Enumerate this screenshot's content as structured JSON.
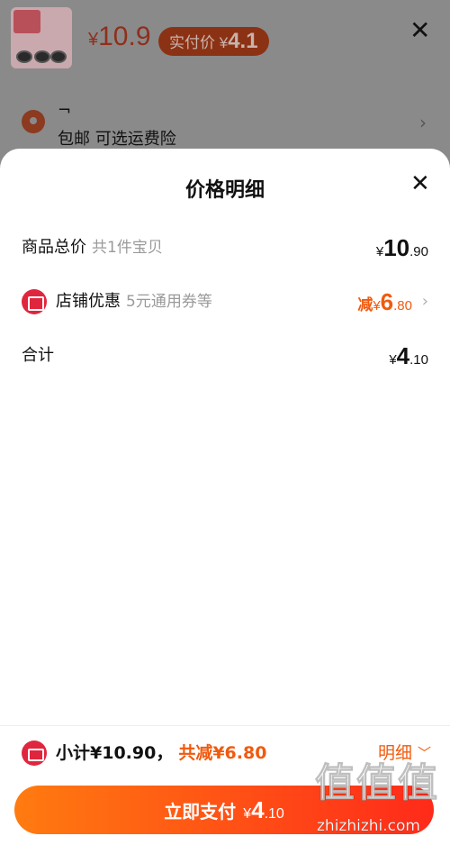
{
  "product": {
    "price_symbol": "¥",
    "price": "10.9",
    "paid_label": "实付价",
    "paid_symbol": "¥",
    "paid_value": "4.1"
  },
  "address": {
    "line1": "¬",
    "line2": "包邮 可选运费险"
  },
  "sheet": {
    "title": "价格明细",
    "rows": {
      "total": {
        "label": "商品总价",
        "sub": "共1件宝贝",
        "yen": "¥",
        "int": "10",
        "dec": ".90"
      },
      "shop_discount": {
        "label": "店铺优惠",
        "sub": "5元通用券等",
        "prefix": "减",
        "yen": "¥",
        "int": "6",
        "dec": ".80"
      },
      "sum": {
        "label": "合计",
        "yen": "¥",
        "int": "4",
        "dec": ".10"
      }
    }
  },
  "footer": {
    "subtotal": "小计¥10.90，",
    "saving": "共减¥6.80",
    "detail": "明细",
    "pay_label": "立即支付",
    "pay_yen": "¥",
    "pay_int": "4",
    "pay_dec": ".10"
  },
  "watermark": {
    "big": "值值值",
    "small": "zhizhizhi.com"
  },
  "colors": {
    "accent": "#f15a0e",
    "shop_icon": "#e0263e",
    "pay_gradient_start": "#ff7b10",
    "pay_gradient_end": "#ff2a1a"
  },
  "icons": {
    "close": "close-icon",
    "location": "location-pin-icon",
    "shop": "shop-icon",
    "coupon": "coupon-icon",
    "chevron_right": "chevron-right-icon",
    "chevron_down": "chevron-down-icon"
  }
}
